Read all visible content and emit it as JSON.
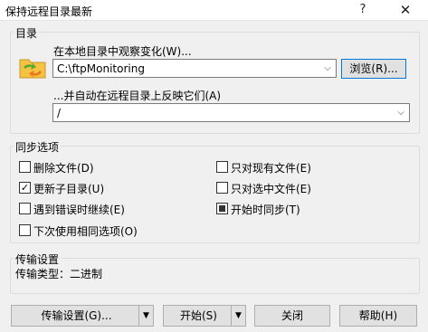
{
  "window": {
    "title": "保持远程目录最新",
    "help_glyph": "?",
    "close_glyph": "✕"
  },
  "directories": {
    "group_label": "目录",
    "local_label": "在本地目录中观察变化(W)...",
    "local_value": "C:\\ftpMonitoring",
    "browse_label": "浏览(R)...",
    "remote_label": "...并自动在远程目录上反映它们(A)",
    "remote_value": "/"
  },
  "sync_options": {
    "group_label": "同步选项",
    "delete_files": {
      "label": "删除文件(D)",
      "checked": false
    },
    "update_subdirs": {
      "label": "更新子目录(U)",
      "checked": true
    },
    "continue_on_error": {
      "label": "遇到错误时继续(E)",
      "checked": false
    },
    "use_same_next_time": {
      "label": "下次使用相同选项(O)",
      "checked": false
    },
    "existing_only": {
      "label": "只对现有文件(E)",
      "checked": false
    },
    "selected_only": {
      "label": "只对选中文件(E)",
      "checked": false
    },
    "sync_on_start": {
      "label": "开始时同步(T)",
      "checked": true
    }
  },
  "transfer": {
    "group_label": "传输设置",
    "type_text": "传输类型：二进制"
  },
  "buttons": {
    "transfer_settings": "传输设置(G)...",
    "start": "开始(S)",
    "close": "关闭",
    "help": "帮助(H)",
    "check_glyph": "✓",
    "dropdown_glyph": "▼",
    "combo_arrow_glyph": "⌵"
  },
  "colors": {
    "accent": "#0078d7",
    "folder_yellow": "#f5c242",
    "arrow_green": "#5aa832",
    "arrow_orange": "#e8761e"
  }
}
